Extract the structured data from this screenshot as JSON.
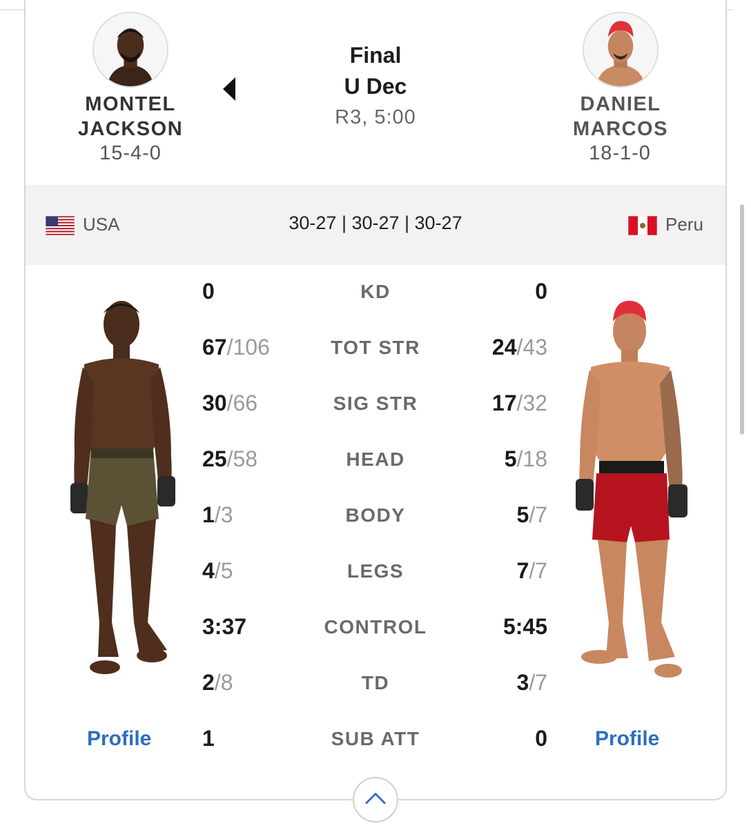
{
  "fight": {
    "status": "Final",
    "method": "U Dec",
    "round_time": "R3, 5:00",
    "scores": "30-27 | 30-27 | 30-27"
  },
  "fighter_left": {
    "first_name": "MONTEL",
    "last_name": "JACKSON",
    "record": "15-4-0",
    "country": "USA",
    "profile_label": "Profile"
  },
  "fighter_right": {
    "first_name": "DANIEL",
    "last_name": "MARCOS",
    "record": "18-1-0",
    "country": "Peru",
    "profile_label": "Profile"
  },
  "stats": [
    {
      "label": "KD",
      "left_landed": "0",
      "left_attempted": "",
      "right_landed": "0",
      "right_attempted": ""
    },
    {
      "label": "TOT STR",
      "left_landed": "67",
      "left_attempted": "106",
      "right_landed": "24",
      "right_attempted": "43"
    },
    {
      "label": "SIG STR",
      "left_landed": "30",
      "left_attempted": "66",
      "right_landed": "17",
      "right_attempted": "32"
    },
    {
      "label": "HEAD",
      "left_landed": "25",
      "left_attempted": "58",
      "right_landed": "5",
      "right_attempted": "18"
    },
    {
      "label": "BODY",
      "left_landed": "1",
      "left_attempted": "3",
      "right_landed": "5",
      "right_attempted": "7"
    },
    {
      "label": "LEGS",
      "left_landed": "4",
      "left_attempted": "5",
      "right_landed": "7",
      "right_attempted": "7"
    },
    {
      "label": "CONTROL",
      "left_landed": "3:37",
      "left_attempted": "",
      "right_landed": "5:45",
      "right_attempted": ""
    },
    {
      "label": "TD",
      "left_landed": "2",
      "left_attempted": "8",
      "right_landed": "3",
      "right_attempted": "7"
    },
    {
      "label": "SUB ATT",
      "left_landed": "1",
      "left_attempted": "",
      "right_landed": "0",
      "right_attempted": ""
    }
  ],
  "icons": {
    "winner_indicator": "triangle-left-icon",
    "collapse": "chevron-up-icon"
  },
  "colors": {
    "accent_red": "#d0021b",
    "link_blue": "#2f6dbd"
  }
}
